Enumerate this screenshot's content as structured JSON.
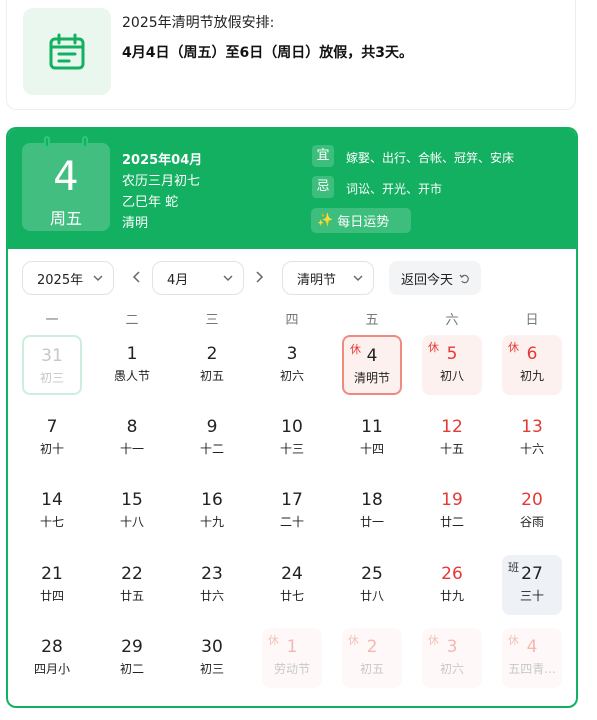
{
  "notice": {
    "title": "2025年清明节放假安排:",
    "desc": "4月4日（周五）至6日（周日）放假，共3天。"
  },
  "header": {
    "day": "4",
    "week": "周五",
    "year_month": "2025年04月",
    "lunar": "农历三月初七",
    "ganzhi": "乙巳年 蛇",
    "festival": "清明",
    "yi_label": "宜",
    "yi_text": "嫁娶、出行、合帐、冠笄、安床",
    "ji_label": "忌",
    "ji_text": "词讼、开光、开市",
    "fortune": "每日运势"
  },
  "controls": {
    "year": "2025年",
    "month": "4月",
    "holiday": "清明节",
    "today": "返回今天"
  },
  "weekdays": [
    "一",
    "二",
    "三",
    "四",
    "五",
    "六",
    "日"
  ],
  "colors": {
    "brand": "#13b061",
    "red": "#e53935"
  },
  "weeks": [
    [
      {
        "n": "31",
        "l": "初三",
        "t": "today-out faded"
      },
      {
        "n": "1",
        "l": "愚人节"
      },
      {
        "n": "2",
        "l": "初五"
      },
      {
        "n": "3",
        "l": "初六"
      },
      {
        "n": "4",
        "l": "清明节",
        "t": "selected",
        "b": "休"
      },
      {
        "n": "5",
        "l": "初八",
        "t": "hol red",
        "b": "休"
      },
      {
        "n": "6",
        "l": "初九",
        "t": "hol red",
        "b": "休"
      }
    ],
    [
      {
        "n": "7",
        "l": "初十"
      },
      {
        "n": "8",
        "l": "十一"
      },
      {
        "n": "9",
        "l": "十二"
      },
      {
        "n": "10",
        "l": "十三"
      },
      {
        "n": "11",
        "l": "十四"
      },
      {
        "n": "12",
        "l": "十五",
        "t": "red"
      },
      {
        "n": "13",
        "l": "十六",
        "t": "red"
      }
    ],
    [
      {
        "n": "14",
        "l": "十七"
      },
      {
        "n": "15",
        "l": "十八"
      },
      {
        "n": "16",
        "l": "十九"
      },
      {
        "n": "17",
        "l": "二十"
      },
      {
        "n": "18",
        "l": "廿一"
      },
      {
        "n": "19",
        "l": "廿二",
        "t": "red"
      },
      {
        "n": "20",
        "l": "谷雨",
        "t": "red"
      }
    ],
    [
      {
        "n": "21",
        "l": "廿四"
      },
      {
        "n": "22",
        "l": "廿五"
      },
      {
        "n": "23",
        "l": "廿六"
      },
      {
        "n": "24",
        "l": "廿七"
      },
      {
        "n": "25",
        "l": "廿八"
      },
      {
        "n": "26",
        "l": "廿九",
        "t": "red"
      },
      {
        "n": "27",
        "l": "三十",
        "t": "work",
        "b": "班"
      }
    ],
    [
      {
        "n": "28",
        "l": "四月小"
      },
      {
        "n": "29",
        "l": "初二"
      },
      {
        "n": "30",
        "l": "初三"
      },
      {
        "n": "1",
        "l": "劳动节",
        "t": "faded-hol",
        "b": "休"
      },
      {
        "n": "2",
        "l": "初五",
        "t": "faded-hol",
        "b": "休"
      },
      {
        "n": "3",
        "l": "初六",
        "t": "faded-hol",
        "b": "休"
      },
      {
        "n": "4",
        "l": "五四青...",
        "t": "faded-hol",
        "b": "休"
      }
    ]
  ]
}
